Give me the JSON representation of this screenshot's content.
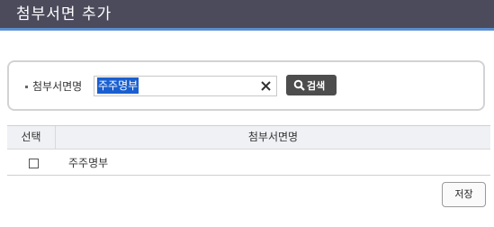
{
  "window": {
    "title": "첨부서면 추가"
  },
  "search": {
    "field_label": "첨부서면명",
    "input_value": "주주명부",
    "clear_icon": "close-icon",
    "button_icon": "search-icon",
    "button_label": "검색"
  },
  "table": {
    "headers": [
      "선택",
      "첨부서면명"
    ],
    "rows": [
      {
        "checked": false,
        "name": "주주명부"
      }
    ]
  },
  "footer": {
    "save_label": "저장"
  },
  "colors": {
    "titlebar_bg": "#4b4b5c",
    "titlebar_accent": "#5a8fd0",
    "selection_highlight": "#1a5fd0",
    "search_button_bg": "#4d4d4d"
  }
}
